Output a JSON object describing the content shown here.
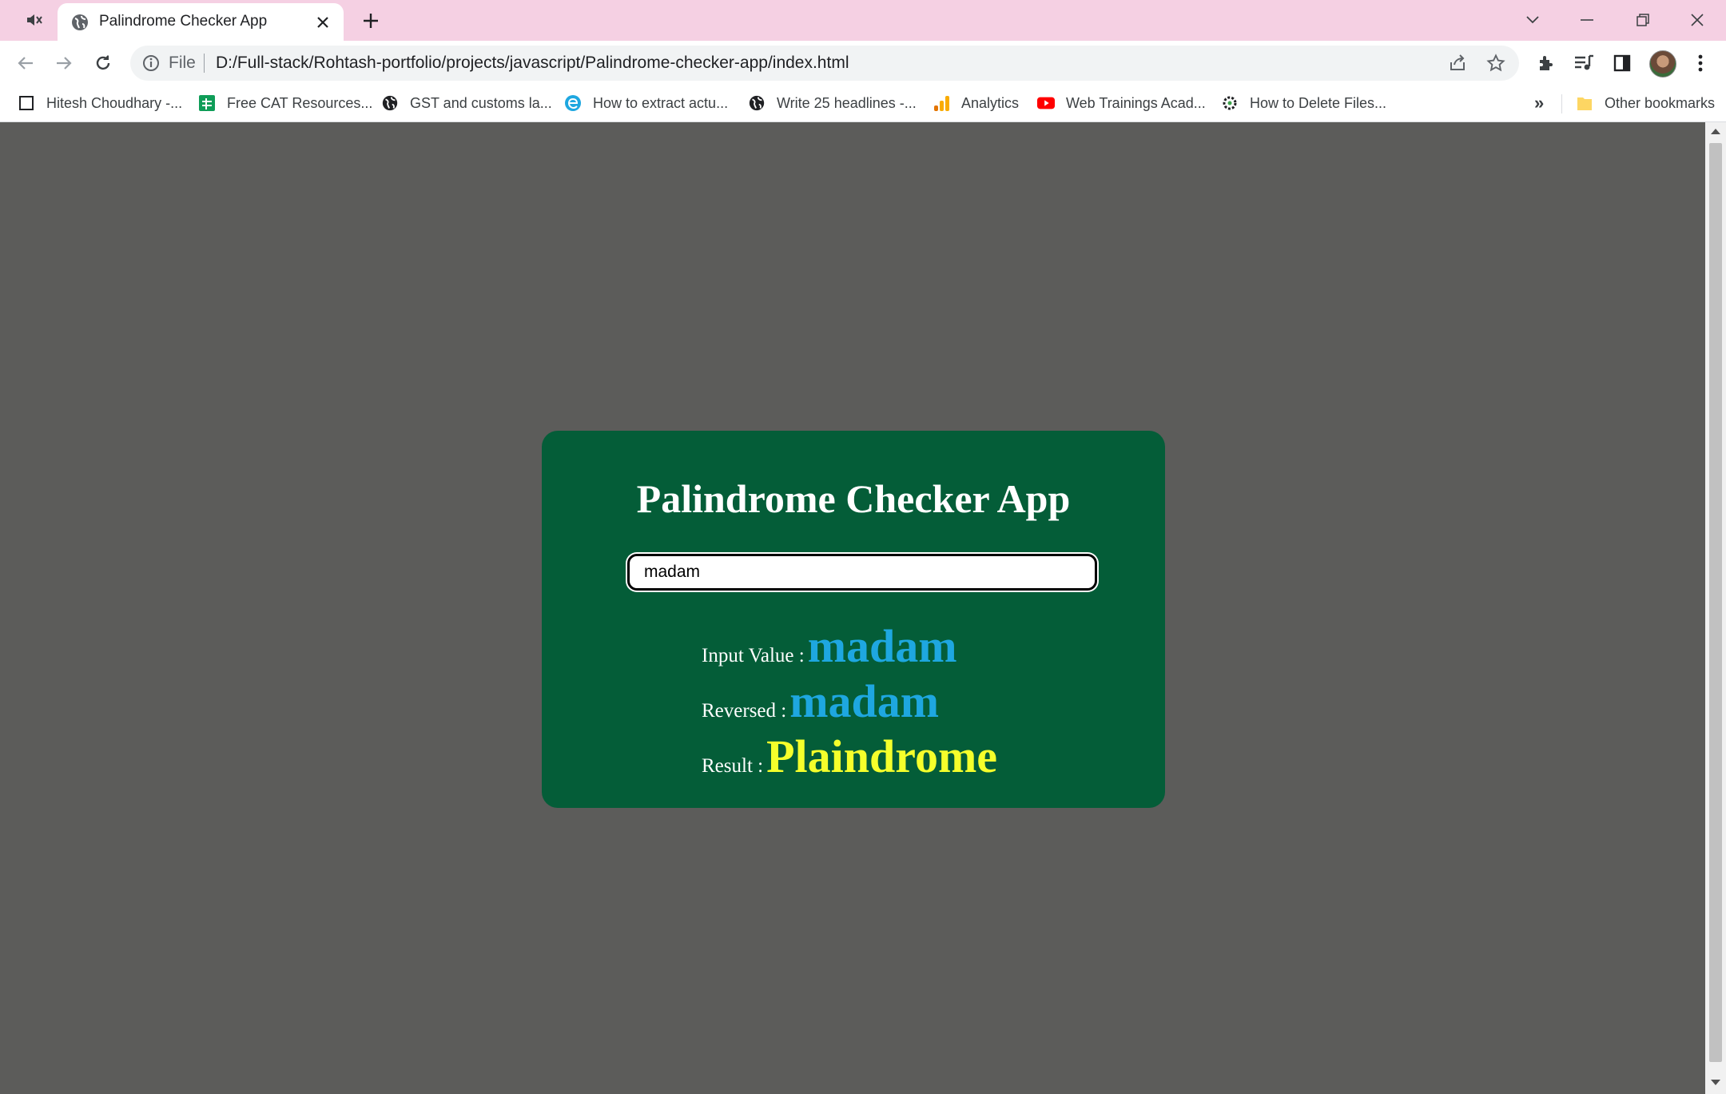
{
  "browser": {
    "tab": {
      "title": "Palindrome Checker App"
    },
    "omnibox": {
      "scheme_label": "File",
      "url": "D:/Full-stack/Rohtash-portfolio/projects/javascript/Palindrome-checker-app/index.html"
    },
    "bookmarks": [
      {
        "label": "Hitesh Choudhary -...",
        "icon": "page-icon"
      },
      {
        "label": "Free CAT Resources...",
        "icon": "sheets-icon"
      },
      {
        "label": "GST and customs la...",
        "icon": "globe-icon"
      },
      {
        "label": "How to extract actu...",
        "icon": "edge-icon"
      },
      {
        "label": "Write 25 headlines -...",
        "icon": "globe-icon"
      },
      {
        "label": "Analytics",
        "icon": "analytics-icon"
      },
      {
        "label": "Web Trainings Acad...",
        "icon": "youtube-icon"
      },
      {
        "label": "How to Delete Files...",
        "icon": "gear-icon"
      }
    ],
    "bookmarks_overflow": "»",
    "other_bookmarks": "Other bookmarks"
  },
  "app": {
    "title": "Palindrome Checker App",
    "input_value": "madam",
    "input_label": "Input Value :",
    "input_display": "madam",
    "reversed_label": "Reversed :",
    "reversed_value": "madam",
    "result_label": "Result :",
    "result_value": "Plaindrome"
  },
  "colors": {
    "titlebar": "#f5d0e3",
    "page_bg": "#5c5c5a",
    "card_bg": "#045d38",
    "value_blue": "#1ea7e0",
    "result_yellow": "#f5ff2b"
  }
}
